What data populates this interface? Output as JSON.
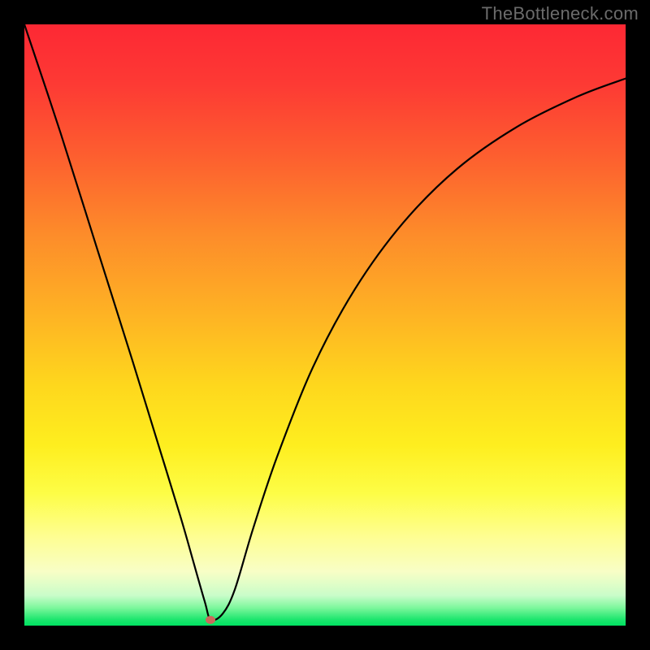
{
  "watermark": "TheBottleneck.com",
  "chart_data": {
    "type": "line",
    "title": "",
    "xlabel": "",
    "ylabel": "",
    "xlim": [
      0,
      100
    ],
    "ylim": [
      0,
      100
    ],
    "grid": false,
    "legend": false,
    "background": "vertical-gradient red→green",
    "series": [
      {
        "name": "bottleneck-curve",
        "x": [
          0,
          6,
          12,
          18,
          22,
          26,
          28,
          30,
          31,
          33,
          35,
          38,
          42,
          48,
          55,
          63,
          72,
          82,
          92,
          100
        ],
        "values": [
          100,
          82,
          63,
          44,
          31,
          18,
          11,
          4,
          1,
          2,
          6,
          16,
          28,
          43,
          56,
          67,
          76,
          83,
          88,
          91
        ]
      }
    ],
    "marker": {
      "x": 31,
      "y": 1,
      "color": "#cb6a5c"
    },
    "gradient_stops": [
      {
        "pct": 0,
        "color": "#fd2834"
      },
      {
        "pct": 35,
        "color": "#fd8c2a"
      },
      {
        "pct": 70,
        "color": "#feee1f"
      },
      {
        "pct": 95,
        "color": "#c9fdc9"
      },
      {
        "pct": 100,
        "color": "#00e262"
      }
    ]
  },
  "layout": {
    "image_size": 800,
    "plot_inset": 30,
    "plot_size": 740
  }
}
